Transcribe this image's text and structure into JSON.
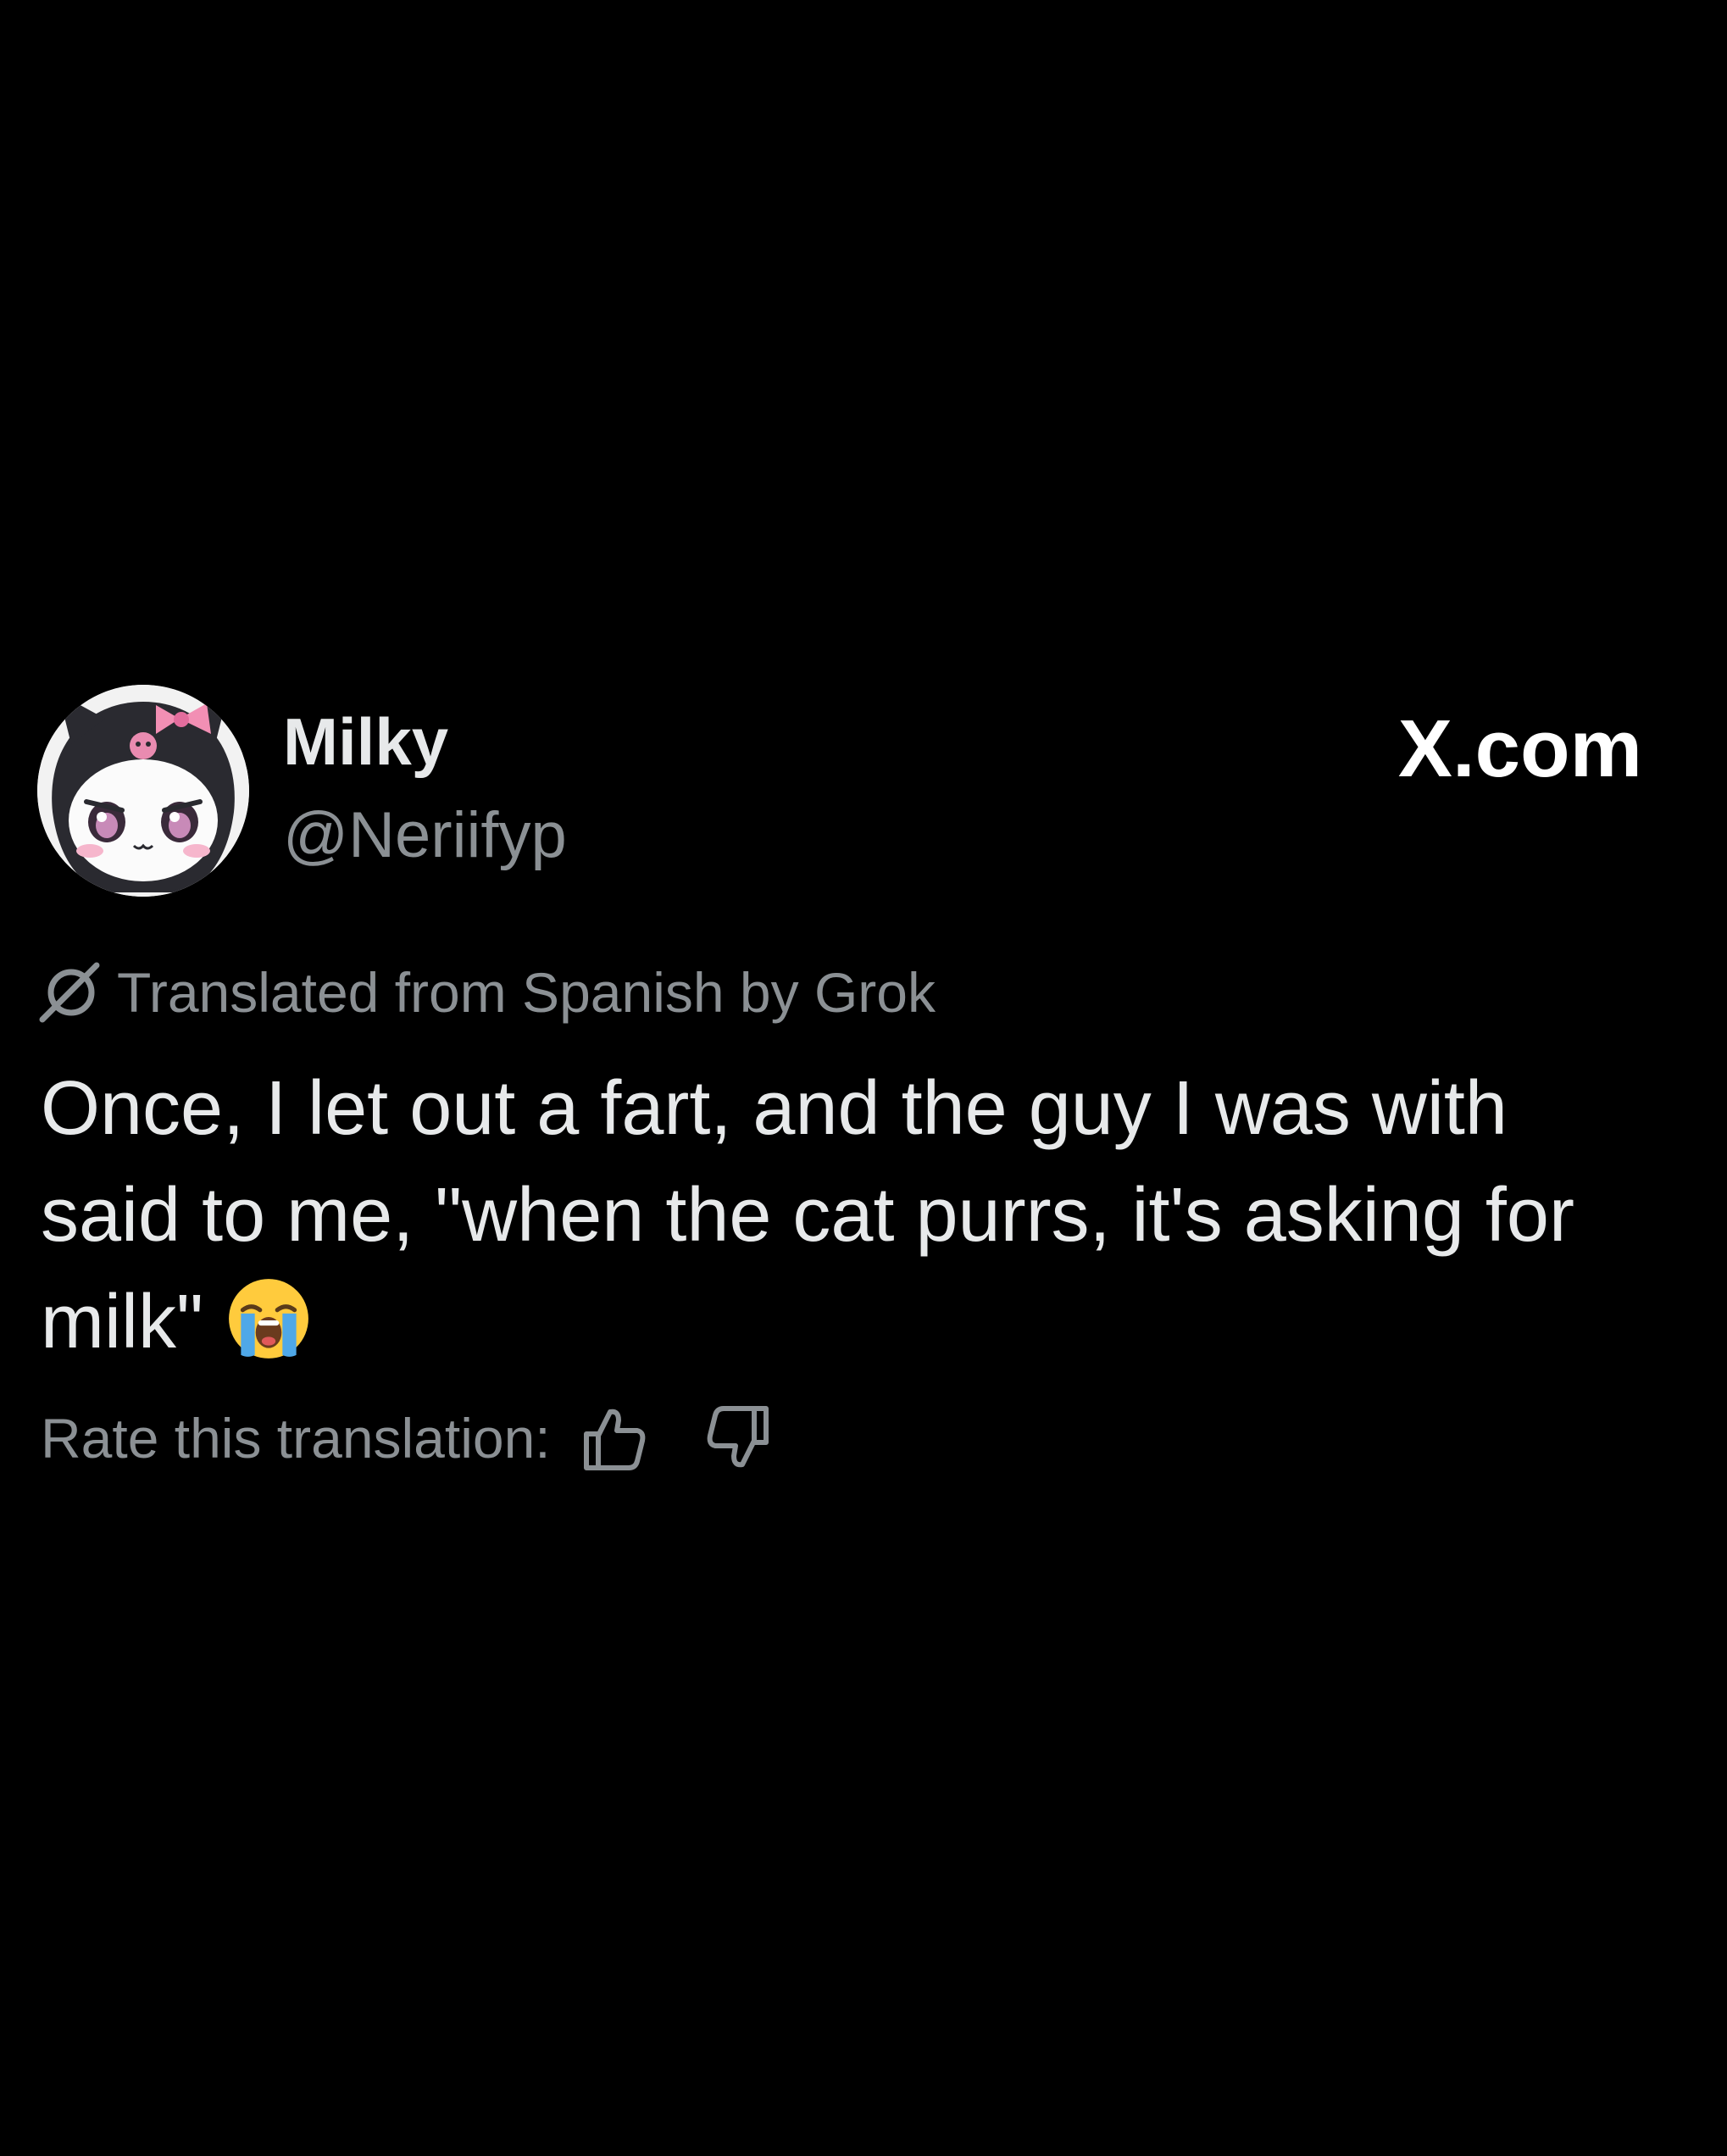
{
  "author": {
    "display_name": "Milky",
    "handle": "@Neriifyp",
    "avatar_icon": "kuromi-character-avatar"
  },
  "brand": {
    "label": "X.com"
  },
  "translation": {
    "notice": "Translated from Spanish by Grok",
    "icon": "grok-icon"
  },
  "post": {
    "lines": [
      "Once, I let out a fart, and the guy I was with",
      "said to me, \"when the cat purrs, it's asking for",
      "milk\""
    ],
    "emoji": "loudly-crying-face"
  },
  "rating": {
    "label": "Rate this translation:",
    "thumbs_up_icon": "thumbs-up-icon",
    "thumbs_down_icon": "thumbs-down-icon"
  },
  "colors": {
    "background": "#000000",
    "primary_text": "#e7e9ea",
    "secondary_text": "#8b9094",
    "brand_text": "#ffffff"
  }
}
